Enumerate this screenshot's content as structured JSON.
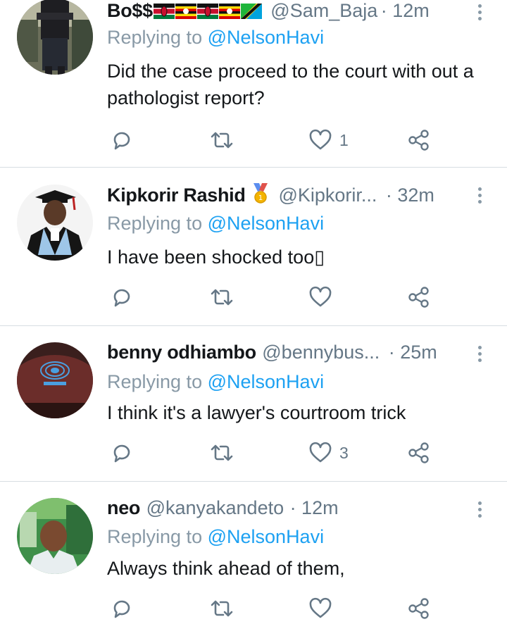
{
  "tweets": [
    {
      "name": "Bo$$",
      "flags": [
        "kenya-flag",
        "uganda-flag",
        "kenya-flag",
        "uganda-flag",
        "tanzania-flag"
      ],
      "handle": "@Sam_Baja",
      "time": "· 12m",
      "replying_prefix": "Replying to",
      "replying_to": "@NelsonHavi",
      "text": "Did the case proceed to the court with out a pathologist report?",
      "likes": "1",
      "avatar": "avatar-man-standing"
    },
    {
      "name": "Kipkorir Rashid",
      "badge_icon": "medal-icon",
      "handle": "@Kipkorir...",
      "time": "· 32m",
      "replying_prefix": "Replying to",
      "replying_to": "@NelsonHavi",
      "text": "I have been shocked too▯",
      "likes": "",
      "avatar": "avatar-graduate"
    },
    {
      "name": "benny odhiambo",
      "handle": "@bennybus...",
      "time": "· 25m",
      "replying_prefix": "Replying to",
      "replying_to": "@NelsonHavi",
      "text": "I think it's a lawyer's courtroom trick",
      "likes": "3",
      "avatar": "avatar-cap"
    },
    {
      "name": "neo",
      "handle": "@kanyakandeto",
      "time": "· 12m",
      "replying_prefix": "Replying to",
      "replying_to": "@NelsonHavi",
      "text": "Always think ahead of them,",
      "likes": "",
      "avatar": "avatar-man-outdoor"
    }
  ],
  "icons": {
    "reply": "reply-icon",
    "retweet": "retweet-icon",
    "like": "heart-icon",
    "share": "share-icon",
    "more": "more-vertical-icon"
  },
  "colors": {
    "link": "#1da1f2",
    "secondary_text": "#657786",
    "icon": "#657786",
    "divider": "#d7dde2"
  }
}
